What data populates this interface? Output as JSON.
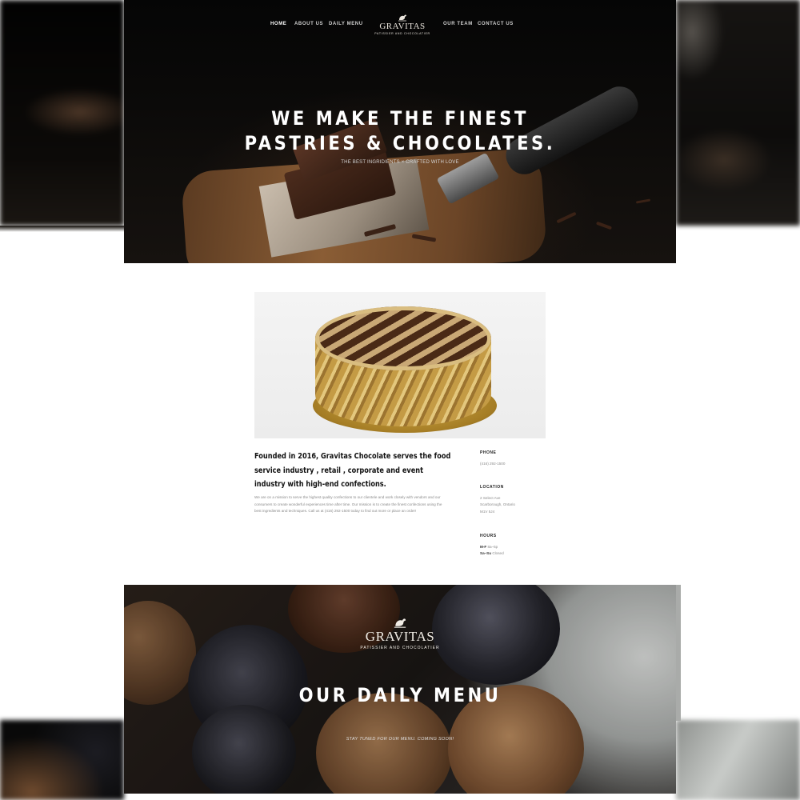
{
  "nav": {
    "home": "HOME",
    "about": "ABOUT US",
    "daily_menu": "DAILY MENU",
    "team": "OUR TEAM",
    "contact": "CONTACT US"
  },
  "brand": {
    "name": "GRAVITAS",
    "tagline": "PATISSIER AND CHOCOLATIER"
  },
  "hero": {
    "title_line1": "WE MAKE THE FINEST",
    "title_line2": "PASTRIES & CHOCOLATES.",
    "subtitle": "THE BEST INGRIDIENTS × CRAFTED WITH LOVE"
  },
  "about": {
    "heading": "Founded in 2016, Gravitas Chocolate serves the food service industry , retail , corporate and event industry with high-end confections.",
    "body": "We are on a mission to serve the highest quality confections to our clientele and work closely with vendors and our consumers to create wonderful experiences time after time. Our mission is to create the finest confections using the best ingredients and techniques. Call us at (416) 292-1500 today to find out more or place an order!"
  },
  "contact_info": {
    "phone_label": "PHONE",
    "phone": "(416) 292-1500",
    "location_label": "LOCATION",
    "address_line1": "2 Select Ave",
    "address_line2": "Scarborough, Ontario",
    "address_line3": "M1V 5J4",
    "hours_label": "HOURS",
    "hours_weekday_days": "M-F",
    "hours_weekday_time": "8a–5p",
    "hours_weekend_days": "Sa–Su",
    "hours_weekend_time": "Closed"
  },
  "menu_section": {
    "title": "OUR DAILY MENU",
    "subtitle": "STAY TUNED FOR OUR MENU. COMING SOON!"
  },
  "colors": {
    "hero_bg": "#0b0a09",
    "text_dark": "#111111",
    "text_muted": "#8a8a8a",
    "gold": "#c49b45"
  }
}
